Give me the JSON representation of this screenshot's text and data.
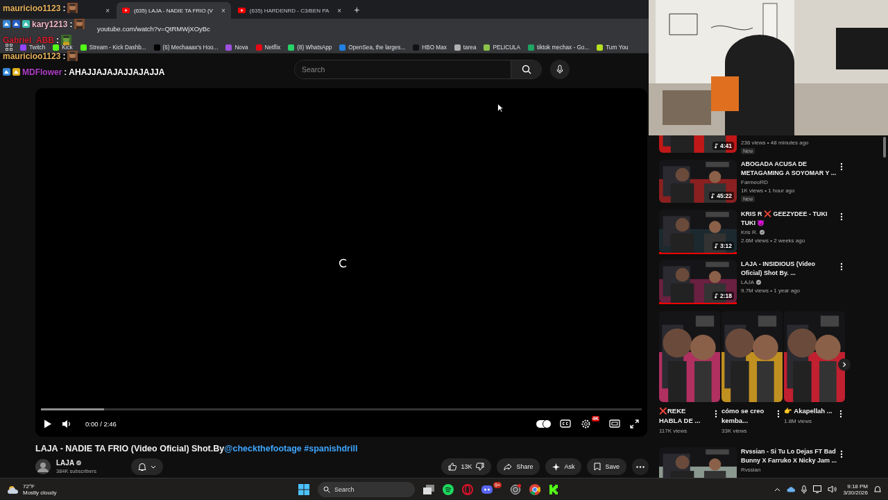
{
  "browser": {
    "tabs": [
      {
        "close": "×",
        "selected": false
      },
      {
        "title": "(635) LAJA - NADIE TA FRIO (V",
        "close": "×",
        "selected": true
      },
      {
        "title": "(635) HARDENRD - C3/BEN PA",
        "close": "×",
        "selected": false
      }
    ],
    "new_tab": "+",
    "address": "youtube.com/watch?v=QtRMWjXOyBc",
    "bookmarks": [
      {
        "label": "Twitch",
        "color": "#9146ff"
      },
      {
        "label": "Kick",
        "color": "#53fc18"
      },
      {
        "label": "Stream - Kick Dashb...",
        "color": "#53fc18"
      },
      {
        "label": "(6) Mechaaax's Hoo...",
        "color": "#000000"
      },
      {
        "label": "Nova",
        "color": "#a050e0"
      },
      {
        "label": "Netflix",
        "color": "#e50914"
      },
      {
        "label": "(8) WhatsApp",
        "color": "#25d366"
      },
      {
        "label": "OpenSea, the larges...",
        "color": "#2081e2"
      },
      {
        "label": "HBO Max",
        "color": "#111111"
      },
      {
        "label": "tarea",
        "color": "#b0b0b0"
      },
      {
        "label": "PELICULA",
        "color": "#8bc34a"
      },
      {
        "label": "tiktok mechax - Go...",
        "color": "#1fa463"
      },
      {
        "label": "Turn You",
        "color": "#b8e020"
      }
    ]
  },
  "chat": [
    {
      "user": "mauricioo1123",
      "color": "#e8b45c",
      "separator": ":",
      "kind": "emote"
    },
    {
      "user": "kary1213",
      "color": "#f2b8c6",
      "separator": ":",
      "kind": "emote",
      "badges": [
        {
          "color": "#3a8ad8"
        },
        {
          "color": "#2a60c8"
        },
        {
          "color": "#40c0b0"
        }
      ]
    },
    {
      "user": "Gabriel_ABB",
      "color": "#d0202e",
      "separator": ":",
      "kind": "emote"
    },
    {
      "user": "mauricioo1123",
      "color": "#e8b45c",
      "separator": ":",
      "kind": "emote"
    },
    {
      "user": "MDFlower",
      "color": "#b040c8",
      "separator": ":",
      "kind": "text",
      "text": "AHAJJAJAJAJJAJAJJA",
      "badges": [
        {
          "color": "#3a8ad8"
        },
        {
          "color": "#e0b020"
        }
      ]
    }
  ],
  "masthead": {
    "search": {
      "placeholder": "Search"
    }
  },
  "player": {
    "buffer": {
      "level": 0.105
    },
    "time": "0:00 / 2:46",
    "autoplay": {
      "on": true
    },
    "quality_badge": "4K"
  },
  "video": {
    "title": "LAJA - NADIE TA FRIO (Video Oficial) Shot.By",
    "links": [
      "@checkthefootage",
      "#spanishdrill"
    ],
    "channel": "LAJA",
    "subscribers": "384K subscribers",
    "likes": "13K",
    "share": "Share",
    "ask": "Ask",
    "save": "Save"
  },
  "sidebar": {
    "items": [
      {
        "kind": "video",
        "meta": "236 views • 48 minutes ago",
        "badge": "New",
        "duration": "4:41"
      },
      {
        "kind": "video",
        "title": "ABOGADA ACUSA DE METAGAMING A SOYOMAR Y ...",
        "channel": "FarmeoRD",
        "verified": false,
        "meta": "1K views • 1 hour ago",
        "badge": "New",
        "duration": "45:22"
      },
      {
        "kind": "video",
        "title": "KRIS R ❌ GEEZYDEE - TUKI TUKI 😈",
        "channel": "Kris R.",
        "verified": true,
        "meta": "2.6M views • 2 weeks ago",
        "duration": "3:12",
        "watched": {
          "level": 1
        }
      },
      {
        "kind": "video",
        "title": "LAJA - INSIDIOUS (Video Oficial) Shot By. ...",
        "channel": "LAJA",
        "verified": true,
        "meta": "9.7M views • 1 year ago",
        "duration": "2:18",
        "watched": {
          "level": 1
        }
      },
      {
        "kind": "shorts",
        "shorts": [
          {
            "title": "❌REKE HABLA DE ...",
            "views": "117K views"
          },
          {
            "title": "cómo se creo kemba...",
            "views": "33K views"
          },
          {
            "title": "👉 Akapellah ...",
            "views": "1.8M views"
          }
        ]
      },
      {
        "kind": "video",
        "title": "Rvssian - Si Tu Lo Dejas FT Bad Bunny X Farruko X Nicky Jam ...",
        "channel": "Rvssian",
        "verified": false
      }
    ]
  },
  "taskbar": {
    "temperature": "72°F",
    "weather": "Mostly cloudy",
    "search": "Search",
    "discord_badge": "9+",
    "time": "9:18 PM",
    "date": "3/30/2026"
  }
}
